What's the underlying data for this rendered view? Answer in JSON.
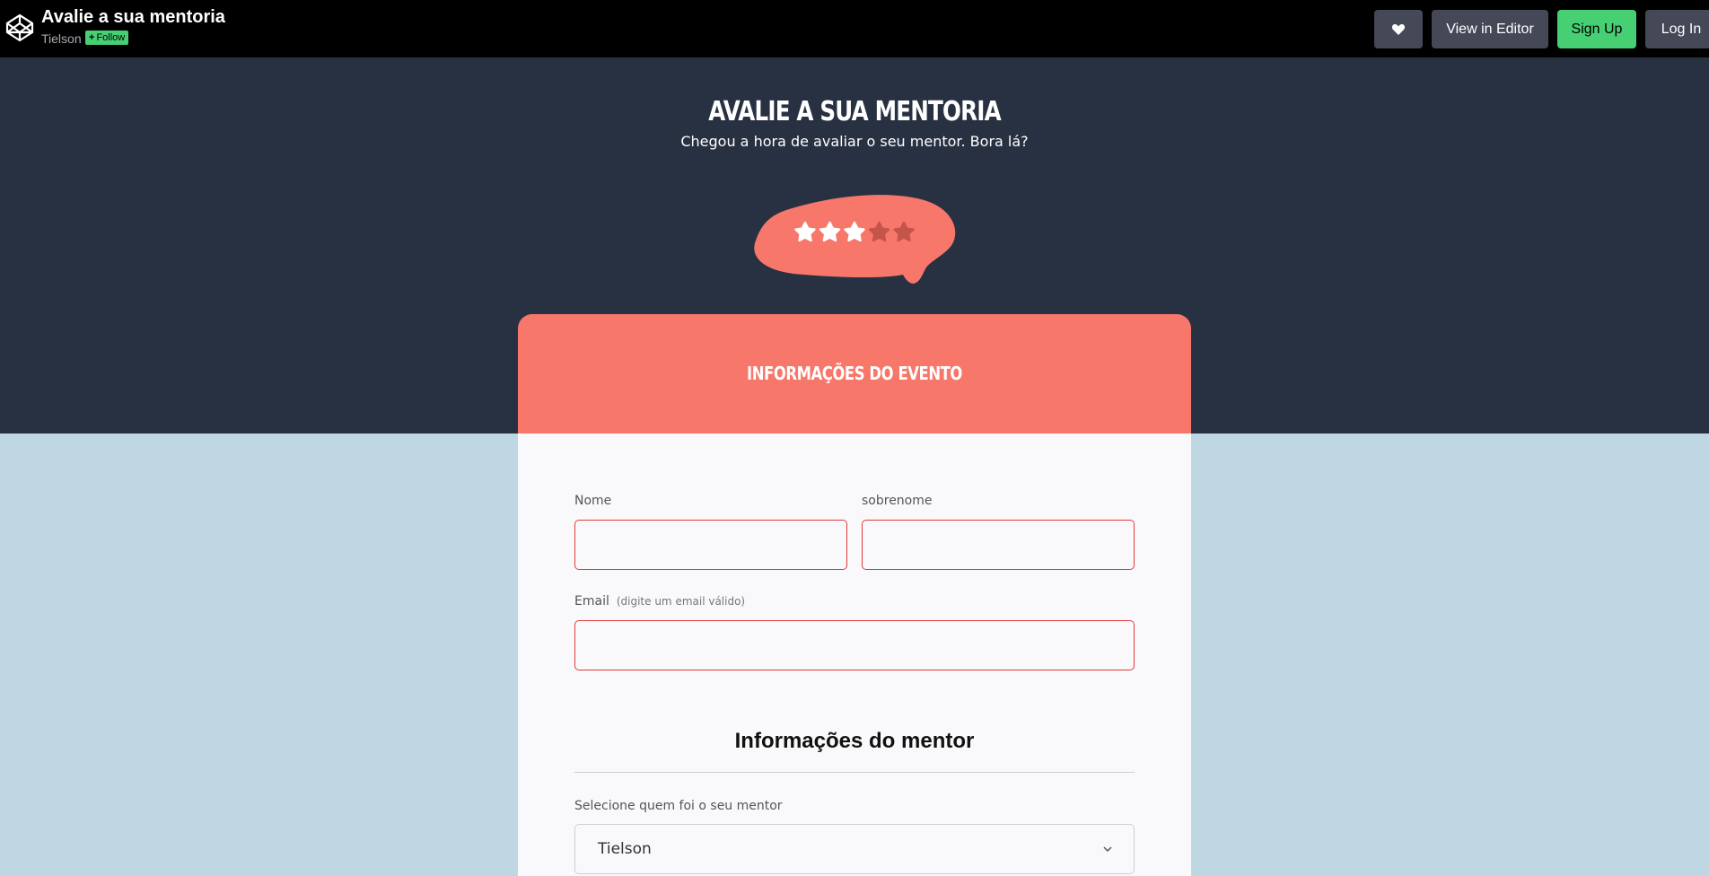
{
  "topbar": {
    "title": "Avalie a sua mentoria",
    "author": "Tielson",
    "follow_label": "Follow",
    "heart_icon": "heart-icon",
    "view_editor_label": "View in Editor",
    "signup_label": "Sign Up",
    "login_label": "Log In"
  },
  "hero": {
    "title": "AVALIE A SUA MENTORIA",
    "subtitle": "Chegou a hora de avaliar o seu mentor. Bora lá?",
    "rating": {
      "filled": 3,
      "total": 5
    }
  },
  "card": {
    "header_title": "INFORMAÇÕES DO EVENTO",
    "fields": {
      "first_name_label": "Nome",
      "last_name_label": "sobrenome",
      "email_label": "Email",
      "email_hint": "(digite um email válido)"
    },
    "mentor_section_title": "Informações do mentor",
    "mentor_select_label": "Selecione quem foi o seu mentor",
    "mentor_select_value": "Tielson"
  },
  "colors": {
    "accent": "#f7776b",
    "hero_bg": "#283142",
    "page_bg": "#bed7e2",
    "invalid_border": "#e23a3a",
    "codepen_green": "#47cf73"
  }
}
